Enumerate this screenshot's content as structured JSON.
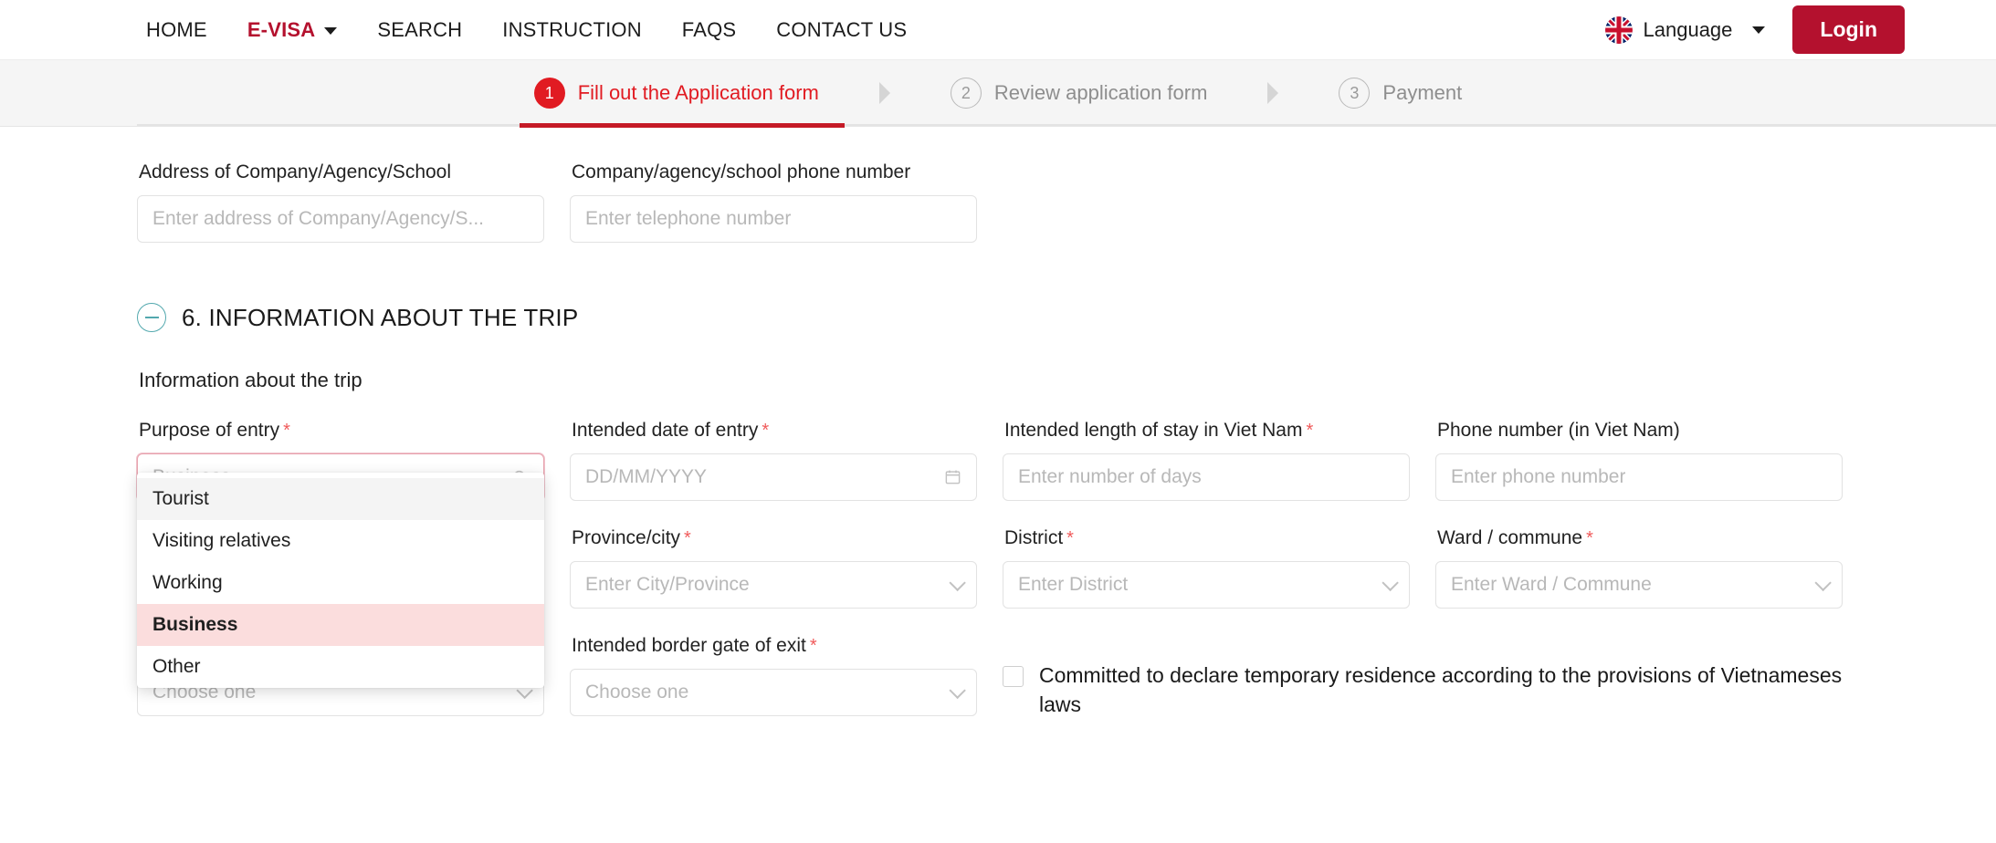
{
  "header": {
    "nav": [
      {
        "label": "HOME",
        "active": false,
        "caret": false
      },
      {
        "label": "E-VISA",
        "active": true,
        "caret": true
      },
      {
        "label": "SEARCH",
        "active": false,
        "caret": false
      },
      {
        "label": "INSTRUCTION",
        "active": false,
        "caret": false
      },
      {
        "label": "FAQS",
        "active": false,
        "caret": false
      },
      {
        "label": "CONTACT US",
        "active": false,
        "caret": false
      }
    ],
    "language_label": "Language",
    "language_icon": "uk-flag-icon",
    "language_caret_icon": "chevron-down-icon",
    "login_label": "Login",
    "accent_color": "#b4112e"
  },
  "stepper": {
    "steps": [
      {
        "num": "1",
        "label": "Fill out the Application form",
        "state": "active"
      },
      {
        "num": "2",
        "label": "Review application form",
        "state": "idle"
      },
      {
        "num": "3",
        "label": "Payment",
        "state": "idle"
      }
    ],
    "active_color": "#e11b22"
  },
  "company": {
    "address_label": "Address of Company/Agency/School",
    "address_placeholder": "Enter address of Company/Agency/S...",
    "phone_label": "Company/agency/school phone number",
    "phone_placeholder": "Enter telephone number"
  },
  "section": {
    "number_title": "6. INFORMATION ABOUT THE TRIP",
    "toggle_icon": "minus-circle-icon",
    "toggle_color": "#52a8ae",
    "subtitle": "Information about the trip"
  },
  "trip": {
    "purpose": {
      "label": "Purpose of entry",
      "required": "*",
      "value": "Business",
      "search_icon": "search-icon",
      "options": [
        {
          "label": "Tourist",
          "state": "hover"
        },
        {
          "label": "Visiting relatives",
          "state": "normal"
        },
        {
          "label": "Working",
          "state": "normal"
        },
        {
          "label": "Business",
          "state": "selected"
        },
        {
          "label": "Other",
          "state": "normal"
        }
      ]
    },
    "entry_date": {
      "label": "Intended date of entry",
      "required": "*",
      "placeholder": "DD/MM/YYYY",
      "icon": "calendar-icon"
    },
    "length_of_stay": {
      "label": "Intended length of stay in Viet Nam",
      "required": "*",
      "placeholder": "Enter number of days"
    },
    "phone_vn": {
      "label": "Phone number (in Viet Nam)",
      "required": "",
      "placeholder": "Enter phone number"
    },
    "province": {
      "label": "Province/city",
      "required": "*",
      "placeholder": "Enter City/Province",
      "icon": "chevron-down-icon"
    },
    "district": {
      "label": "District",
      "required": "*",
      "placeholder": "Enter District",
      "icon": "chevron-down-icon"
    },
    "ward": {
      "label": "Ward / commune",
      "required": "*",
      "placeholder": "Enter Ward / Commune",
      "icon": "chevron-down-icon"
    },
    "border_gate_entry": {
      "placeholder": "Choose one",
      "icon": "chevron-down-icon"
    },
    "border_gate_exit": {
      "label": "Intended border gate of exit",
      "required": "*",
      "placeholder": "Choose one",
      "icon": "chevron-down-icon"
    },
    "commitment": {
      "text": "Committed to declare temporary residence according to the provisions of Vietnameses laws",
      "checked": false
    }
  }
}
